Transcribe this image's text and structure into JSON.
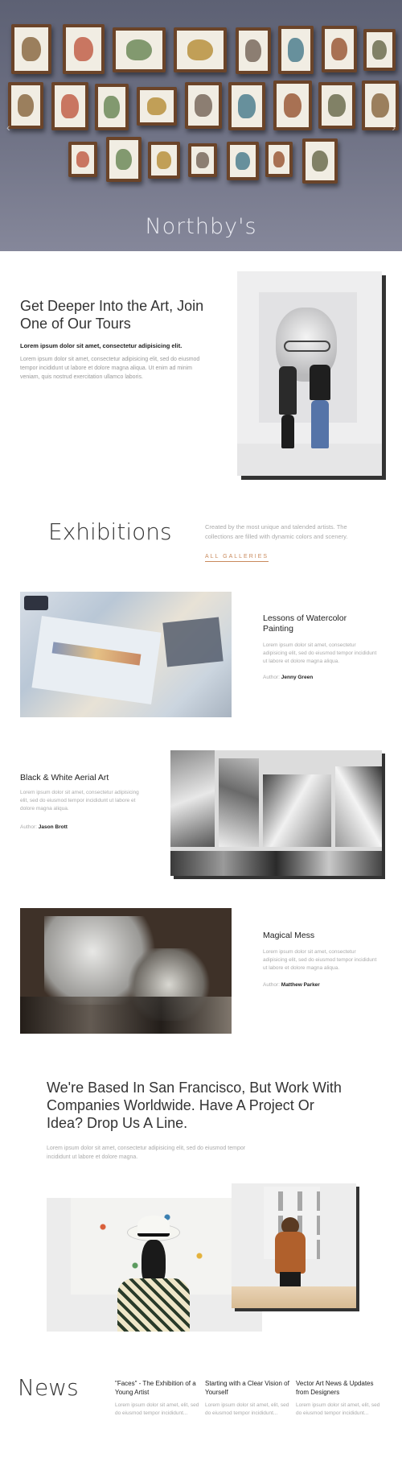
{
  "hero": {
    "title": "Northby's",
    "arrow_prev": "‹",
    "arrow_next": "›"
  },
  "tours": {
    "heading": "Get Deeper Into the Art, Join One of Our Tours",
    "lead": "Lorem ipsum dolor sit amet, consectetur adipisicing elit.",
    "body": "Lorem ipsum dolor sit amet, consectetur adipisicing elit, sed do eiusmod tempor incididunt ut labore et dolore magna aliqua. Ut enim ad minim veniam, quis nostrud exercitation ullamco laboris."
  },
  "exhibitions": {
    "title": "Exhibitions",
    "description": "Created by the most unique and talended artists. The collections are filled with dynamic colors and scenery.",
    "link": "ALL GALLERIES",
    "items": [
      {
        "title": "Lessons of Watercolor Painting",
        "text": "Lorem ipsum dolor sit amet, consectetur adipisicing elit, sed do eiusmod tempor incididunt ut labore et dolore magna aliqua.",
        "author_label": "Author:",
        "author": "Jenny Green"
      },
      {
        "title": "Black & White Aerial Art",
        "text": "Lorem ipsum dolor sit amet, consectetur adipisicing elit, sed do eiusmod tempor incididunt ut labore et dolore magna aliqua.",
        "author_label": "Author:",
        "author": "Jason Brott"
      },
      {
        "title": "Magical Mess",
        "text": "Lorem ipsum dolor sit amet, consectetur adipisicing elit, sed do eiusmod tempor incididunt ut labore et dolore magna aliqua.",
        "author_label": "Author:",
        "author": "Matthew Parker"
      }
    ]
  },
  "contact": {
    "heading": "We're Based In San Francisco, But Work With Companies Worldwide. Have A Project Or Idea? Drop Us A Line.",
    "body": "Lorem ipsum dolor sit amet, consectetur adipisicing elit, sed do eiusmod tempor incididunt ut labore et dolore magna."
  },
  "news": {
    "title": "News",
    "items": [
      {
        "title": "\"Faces\" - The Exhibition of a Young Artist",
        "body": "Lorem ipsum dolor sit amet, elit, sed do eiusmod tempor incididunt..."
      },
      {
        "title": "Starting with a Clear Vision of Yourself",
        "body": "Lorem ipsum dolor sit amet, elit, sed do eiusmod tempor incididunt..."
      },
      {
        "title": "Vector Art News & Updates from Designers",
        "body": "Lorem ipsum dolor sit amet, elit, sed do eiusmod tempor incididunt..."
      }
    ]
  },
  "colors": {
    "accent": "#c98a5c",
    "heading": "#333333",
    "muted_text": "#aaaaaa",
    "frame_wood": "#6b4429",
    "hero_wall": "#6c6f82"
  }
}
